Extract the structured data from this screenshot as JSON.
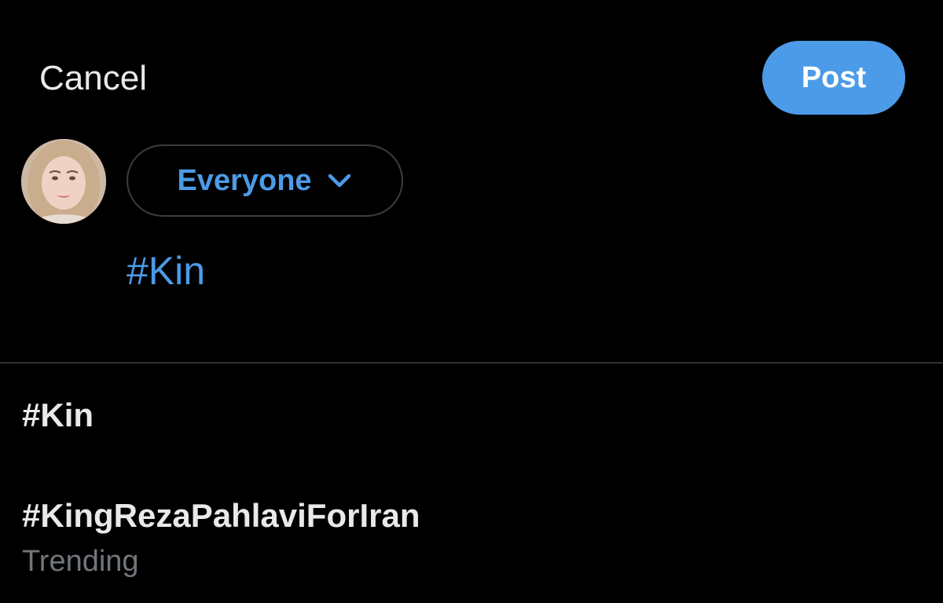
{
  "header": {
    "cancel_label": "Cancel",
    "post_label": "Post"
  },
  "composer": {
    "audience_label": "Everyone",
    "text": "#Kin"
  },
  "suggestions": [
    {
      "title": "#Kin",
      "subtitle": ""
    },
    {
      "title": "#KingRezaPahlaviForIran",
      "subtitle": "Trending"
    }
  ],
  "colors": {
    "accent": "#4c9be8",
    "background": "#000000",
    "text": "#e7e9ea",
    "secondary_text": "#71767b",
    "divider": "#2f3336"
  },
  "icons": {
    "audience_dropdown": "chevron-down-icon",
    "avatar": "user-avatar"
  }
}
